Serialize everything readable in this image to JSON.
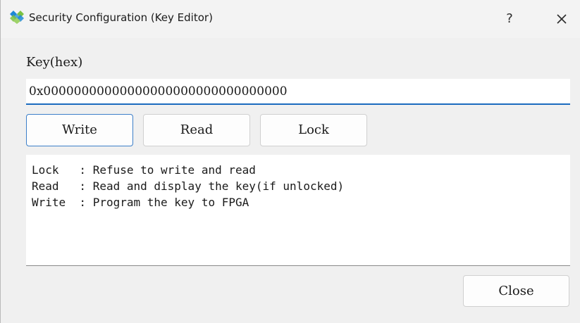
{
  "window": {
    "title": "Security Configuration (Key Editor)",
    "help_glyph": "?",
    "icons": {
      "app": "gowin-logo-icon",
      "close": "close-icon"
    }
  },
  "key": {
    "label": "Key(hex)",
    "value": "0x00000000000000000000000000000000"
  },
  "buttons": {
    "write": "Write",
    "read": "Read",
    "lock": "Lock",
    "close": "Close"
  },
  "info": {
    "lines": [
      "Lock   : Refuse to write and read",
      "Read   : Read and display the key(if unlocked)",
      "Write  : Program the key to FPGA"
    ]
  },
  "colors": {
    "focus_accent": "#1b6bbf",
    "logo_green": "#7bc142",
    "logo_blue": "#1e88d6"
  }
}
